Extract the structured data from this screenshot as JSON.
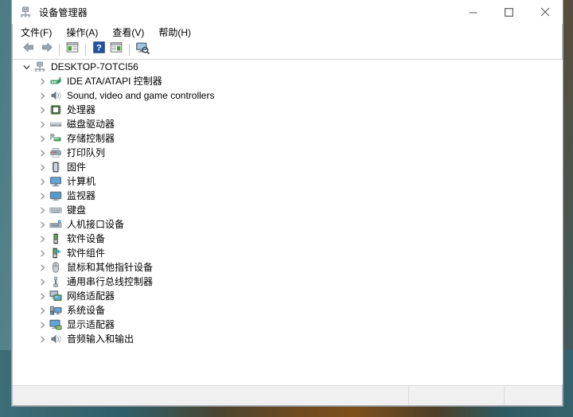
{
  "window": {
    "title": "设备管理器",
    "title_icon": "device-manager-icon",
    "minimize_label": "最小化",
    "maximize_label": "最大化",
    "close_label": "关闭"
  },
  "menubar": {
    "items": [
      {
        "label": "文件(F)",
        "name": "menu-file"
      },
      {
        "label": "操作(A)",
        "name": "menu-action"
      },
      {
        "label": "查看(V)",
        "name": "menu-view"
      },
      {
        "label": "帮助(H)",
        "name": "menu-help"
      }
    ]
  },
  "toolbar": {
    "buttons": [
      {
        "name": "back-button",
        "icon": "back-arrow-icon"
      },
      {
        "name": "forward-button",
        "icon": "forward-arrow-icon"
      },
      {
        "name": "properties-button",
        "icon": "properties-icon"
      },
      {
        "name": "help-button",
        "icon": "help-question-icon"
      },
      {
        "name": "show-hidden-button",
        "icon": "show-panel-icon"
      },
      {
        "name": "scan-hardware-changes-button",
        "icon": "scan-hardware-icon"
      }
    ]
  },
  "tree": {
    "root": {
      "label": "DESKTOP-7OTCI56",
      "icon": "computer-root-icon",
      "expanded": true
    },
    "items": [
      {
        "label": "IDE ATA/ATAPI 控制器",
        "icon": "ide-controller-icon"
      },
      {
        "label": "Sound, video and game controllers",
        "icon": "sound-video-game-icon"
      },
      {
        "label": "处理器",
        "icon": "processor-icon"
      },
      {
        "label": "磁盘驱动器",
        "icon": "disk-drive-icon"
      },
      {
        "label": "存储控制器",
        "icon": "storage-controller-icon"
      },
      {
        "label": "打印队列",
        "icon": "print-queue-icon"
      },
      {
        "label": "固件",
        "icon": "firmware-icon"
      },
      {
        "label": "计算机",
        "icon": "computer-icon"
      },
      {
        "label": "监视器",
        "icon": "monitor-icon"
      },
      {
        "label": "键盘",
        "icon": "keyboard-icon"
      },
      {
        "label": "人机接口设备",
        "icon": "hid-device-icon"
      },
      {
        "label": "软件设备",
        "icon": "software-device-icon"
      },
      {
        "label": "软件组件",
        "icon": "software-component-icon"
      },
      {
        "label": "鼠标和其他指针设备",
        "icon": "mouse-pointer-icon"
      },
      {
        "label": "通用串行总线控制器",
        "icon": "usb-controller-icon"
      },
      {
        "label": "网络适配器",
        "icon": "network-adapter-icon"
      },
      {
        "label": "系统设备",
        "icon": "system-device-icon"
      },
      {
        "label": "显示适配器",
        "icon": "display-adapter-icon"
      },
      {
        "label": "音频输入和输出",
        "icon": "audio-io-icon"
      }
    ]
  },
  "statusbar": {
    "main_text": "",
    "panel2_text": "",
    "panel3_text": ""
  },
  "colors": {
    "window_bg": "#ffffff",
    "statusbar_bg": "#f0f0f0",
    "border": "#9aa0a6",
    "text": "#000000",
    "twisty": "#8a8a8a",
    "accent_blue": "#1b63b5"
  }
}
